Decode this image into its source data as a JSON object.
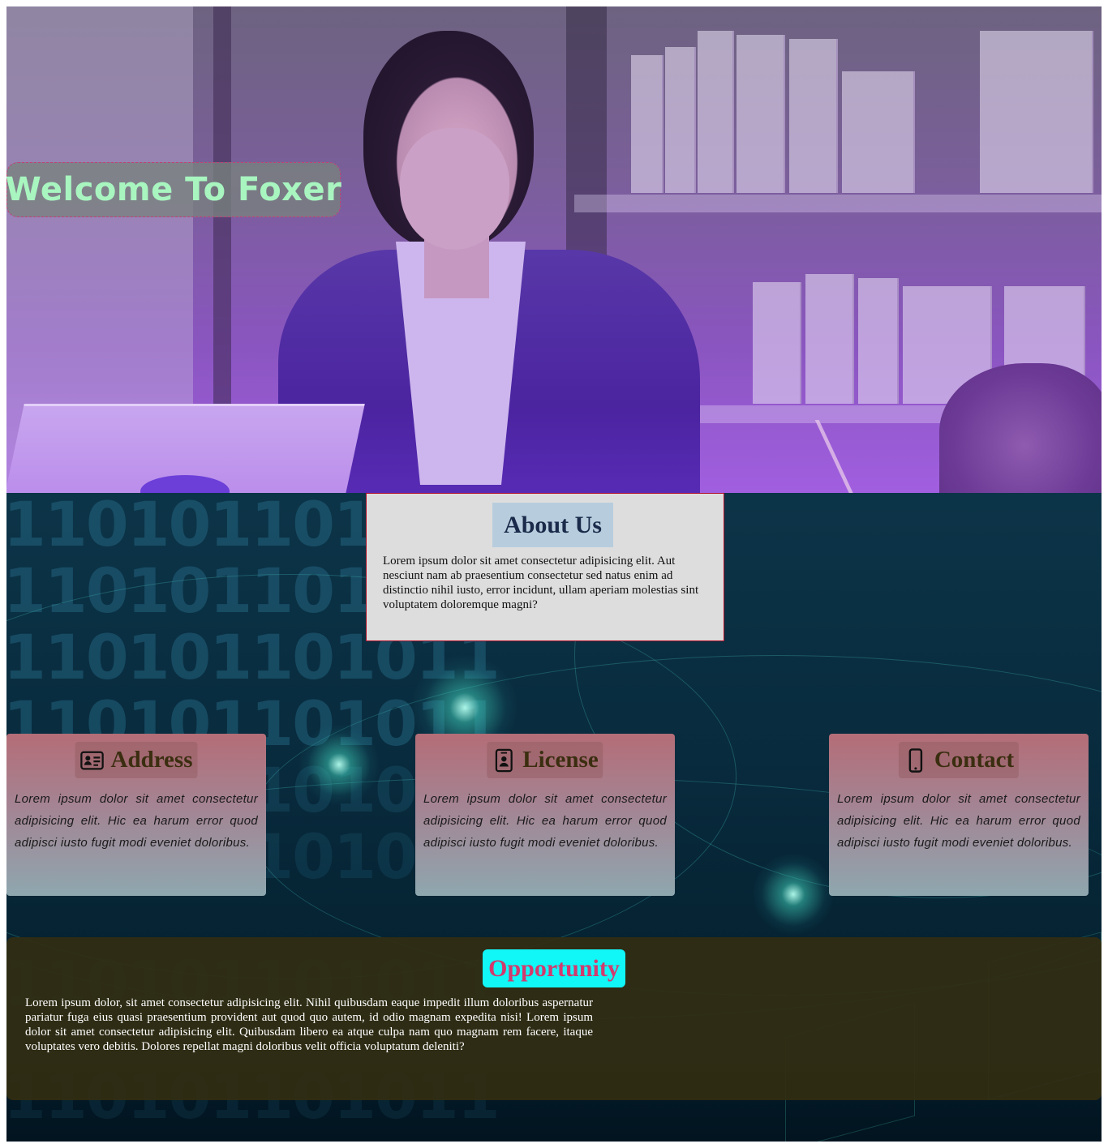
{
  "hero": {
    "title": "Welcome To Foxer"
  },
  "about": {
    "title": "About Us",
    "text": "Lorem ipsum dolor sit amet consectetur adipisicing elit. Aut nesciunt nam ab praesentium consectetur sed natus enim ad distinctio nihil iusto, error incidunt, ullam aperiam molestias sint voluptatem doloremque magni?"
  },
  "binary_rows": [
    "110101101011",
    "110101101011",
    "110101101011",
    "110101101011",
    "110101101011",
    "110101101011",
    "110101101011",
    "110101101011"
  ],
  "cards": [
    {
      "icon": "id-card-icon",
      "title": "Address",
      "text": "Lorem ipsum dolor sit amet consectetur adipisicing elit. Hic ea harum error quod adipisci iusto fugit modi eveniet doloribus."
    },
    {
      "icon": "badge-icon",
      "title": "License",
      "text": "Lorem ipsum dolor sit amet consectetur adipisicing elit. Hic ea harum error quod adipisci iusto fugit modi eveniet doloribus."
    },
    {
      "icon": "mobile-phone-icon",
      "title": "Contact",
      "text": "Lorem ipsum dolor sit amet consectetur adipisicing elit. Hic ea harum error quod adipisci iusto fugit modi eveniet doloribus."
    }
  ],
  "opportunity": {
    "title": "Opportunity",
    "text": "Lorem ipsum dolor, sit amet consectetur adipisicing elit. Nihil quibusdam eaque impedit illum doloribus aspernatur pariatur fuga eius quasi praesentium provident aut quod quo autem, id odio magnam expedita nisi! Lorem ipsum dolor sit amet consectetur adipisicing elit. Quibusdam libero ea atque culpa nam quo magnam rem facere, itaque voluptates vero debitis. Dolores repellat magni doloribus velit officia voluptatum deleniti?"
  },
  "colors": {
    "welcome_text": "#a8f5c0",
    "about_bg": "#dddddd",
    "about_title_bg": "#b7cddd",
    "card_title": "#3b2e10",
    "opportunity_title_bg": "#11f6f6",
    "opportunity_title": "#d23a6e",
    "opportunity_bg": "#322d12"
  }
}
